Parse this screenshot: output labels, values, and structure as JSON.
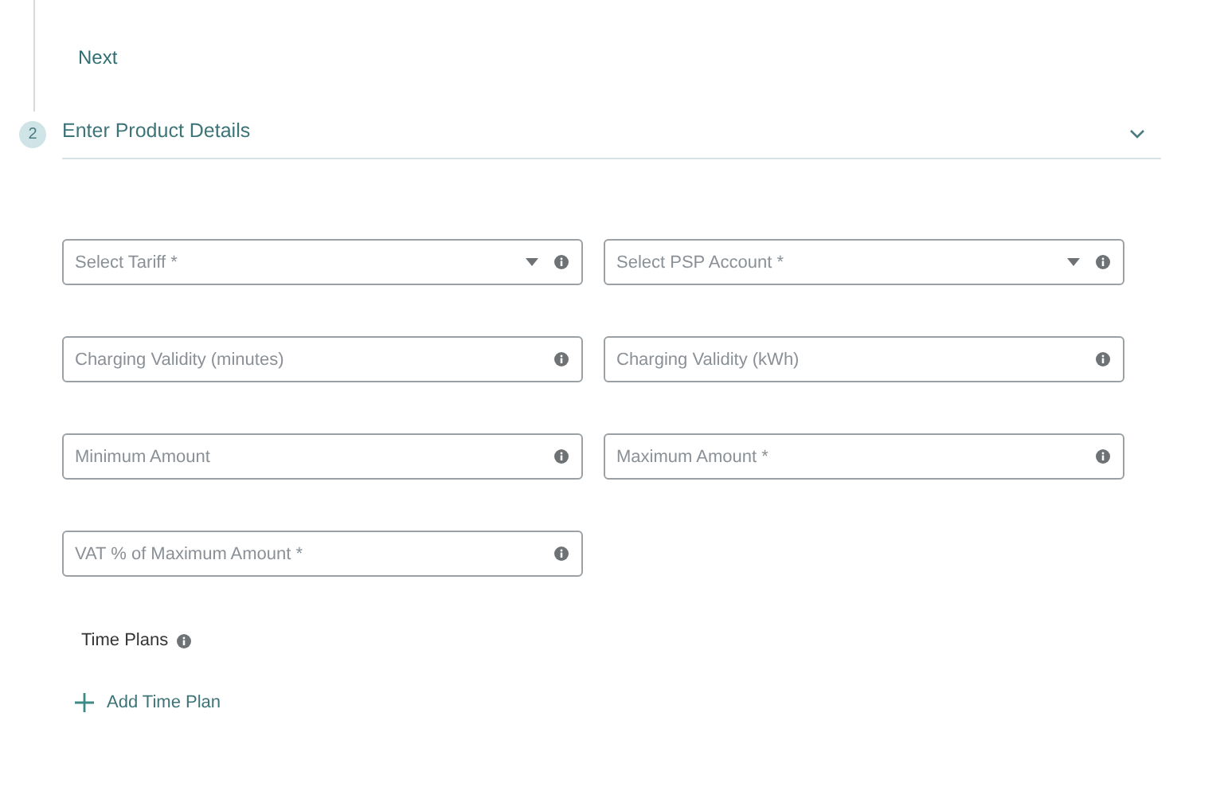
{
  "previous_step": {
    "next_button": "Next"
  },
  "step": {
    "number": "2",
    "title": "Enter Product Details",
    "expanded": true
  },
  "fields": [
    {
      "kind": "select",
      "placeholder": "Select Tariff *"
    },
    {
      "kind": "select",
      "placeholder": "Select PSP Account *"
    },
    {
      "kind": "input",
      "placeholder": "Charging Validity (minutes)"
    },
    {
      "kind": "input",
      "placeholder": "Charging Validity (kWh)"
    },
    {
      "kind": "input",
      "placeholder": "Minimum Amount"
    },
    {
      "kind": "input",
      "placeholder": "Maximum Amount *"
    },
    {
      "kind": "input",
      "placeholder": "VAT % of Maximum Amount *"
    }
  ],
  "time_plans": {
    "label": "Time Plans",
    "add_button": "Add Time Plan"
  }
}
